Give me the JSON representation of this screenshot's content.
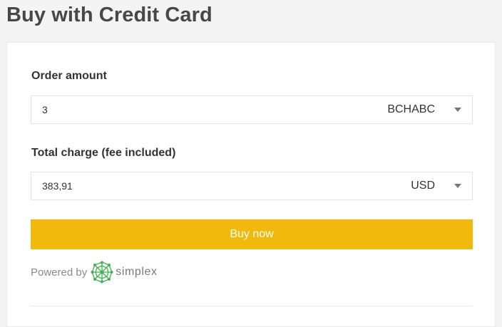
{
  "page": {
    "title": "Buy with Credit Card"
  },
  "order": {
    "label": "Order amount",
    "value": "3",
    "currency": "BCHABC"
  },
  "total": {
    "label": "Total charge (fee included)",
    "value": "383,91",
    "currency": "USD"
  },
  "buy_button": {
    "label": "Buy now"
  },
  "powered_by": {
    "text": "Powered by",
    "brand": "simplex",
    "logo_icon": "simplex-logo-icon"
  },
  "colors": {
    "accent": "#f0b90b",
    "brand_green": "#3fb34f",
    "page_background": "#f4f4f4"
  }
}
